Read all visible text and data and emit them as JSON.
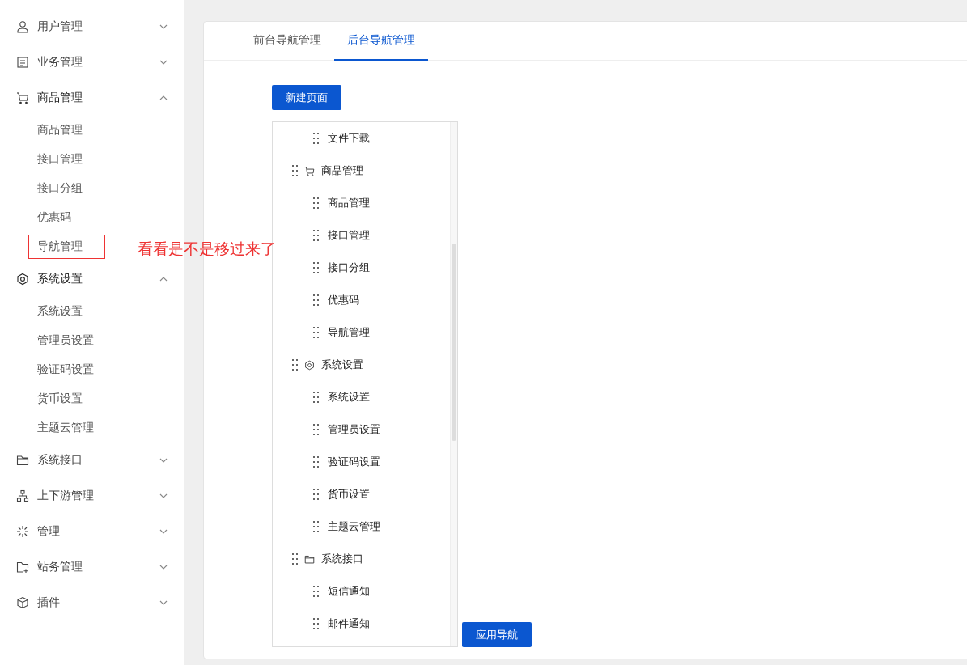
{
  "sidebar": {
    "groups": [
      {
        "kind": "user",
        "label": "用户管理",
        "expanded": false
      },
      {
        "kind": "document",
        "label": "业务管理",
        "expanded": false
      },
      {
        "kind": "cart",
        "label": "商品管理",
        "expanded": true,
        "children": [
          {
            "label": "商品管理",
            "boxed": false
          },
          {
            "label": "接口管理",
            "boxed": false
          },
          {
            "label": "接口分组",
            "boxed": false
          },
          {
            "label": "优惠码",
            "boxed": false
          },
          {
            "label": "导航管理",
            "boxed": true
          }
        ]
      },
      {
        "kind": "hexagon",
        "label": "系统设置",
        "expanded": true,
        "children": [
          {
            "label": "系统设置",
            "boxed": false
          },
          {
            "label": "管理员设置",
            "boxed": false
          },
          {
            "label": "验证码设置",
            "boxed": false
          },
          {
            "label": "货币设置",
            "boxed": false
          },
          {
            "label": "主题云管理",
            "boxed": false
          }
        ]
      },
      {
        "kind": "folder",
        "label": "系统接口",
        "expanded": false
      },
      {
        "kind": "hierarchy",
        "label": "上下游管理",
        "expanded": false
      },
      {
        "kind": "burst",
        "label": "管理",
        "expanded": false
      },
      {
        "kind": "folder-plus",
        "label": "站务管理",
        "expanded": false
      },
      {
        "kind": "cube",
        "label": "插件",
        "expanded": false
      }
    ]
  },
  "annotation": {
    "text": "看看是不是移过来了"
  },
  "tabs": [
    {
      "label": "前台导航管理",
      "selected": false
    },
    {
      "label": "后台导航管理",
      "selected": true
    }
  ],
  "new_page_button": "新建页面",
  "tree": {
    "items": [
      {
        "children": [
          {
            "label": "文件下载"
          }
        ]
      },
      {
        "kind": "cart",
        "label": "商品管理",
        "children": [
          {
            "label": "商品管理"
          },
          {
            "label": "接口管理"
          },
          {
            "label": "接口分组"
          },
          {
            "label": "优惠码"
          },
          {
            "label": "导航管理"
          }
        ]
      },
      {
        "kind": "hexagon",
        "label": "系统设置",
        "children": [
          {
            "label": "系统设置"
          },
          {
            "label": "管理员设置"
          },
          {
            "label": "验证码设置"
          },
          {
            "label": "货币设置"
          },
          {
            "label": "主题云管理"
          }
        ]
      },
      {
        "kind": "folder",
        "label": "系统接口",
        "children": [
          {
            "label": "短信通知"
          },
          {
            "label": "邮件通知"
          }
        ]
      }
    ]
  },
  "apply_button": "应用导航"
}
